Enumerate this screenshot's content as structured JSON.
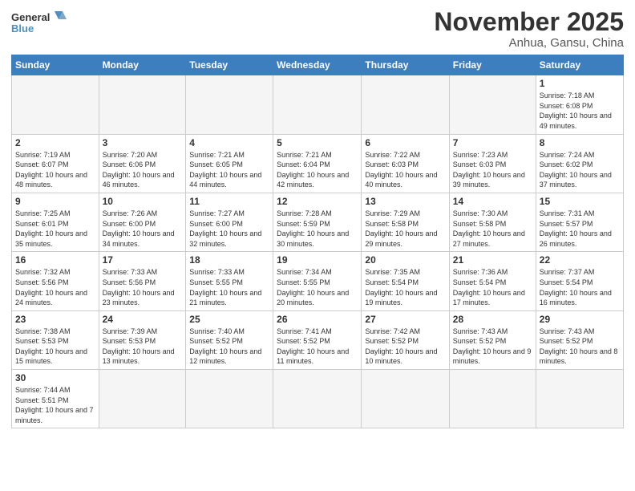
{
  "logo": {
    "text_general": "General",
    "text_blue": "Blue"
  },
  "title": "November 2025",
  "location": "Anhua, Gansu, China",
  "days_of_week": [
    "Sunday",
    "Monday",
    "Tuesday",
    "Wednesday",
    "Thursday",
    "Friday",
    "Saturday"
  ],
  "weeks": [
    [
      {
        "day": "",
        "info": ""
      },
      {
        "day": "",
        "info": ""
      },
      {
        "day": "",
        "info": ""
      },
      {
        "day": "",
        "info": ""
      },
      {
        "day": "",
        "info": ""
      },
      {
        "day": "",
        "info": ""
      },
      {
        "day": "1",
        "info": "Sunrise: 7:18 AM\nSunset: 6:08 PM\nDaylight: 10 hours\nand 49 minutes."
      }
    ],
    [
      {
        "day": "2",
        "info": "Sunrise: 7:19 AM\nSunset: 6:07 PM\nDaylight: 10 hours\nand 48 minutes."
      },
      {
        "day": "3",
        "info": "Sunrise: 7:20 AM\nSunset: 6:06 PM\nDaylight: 10 hours\nand 46 minutes."
      },
      {
        "day": "4",
        "info": "Sunrise: 7:21 AM\nSunset: 6:05 PM\nDaylight: 10 hours\nand 44 minutes."
      },
      {
        "day": "5",
        "info": "Sunrise: 7:21 AM\nSunset: 6:04 PM\nDaylight: 10 hours\nand 42 minutes."
      },
      {
        "day": "6",
        "info": "Sunrise: 7:22 AM\nSunset: 6:03 PM\nDaylight: 10 hours\nand 40 minutes."
      },
      {
        "day": "7",
        "info": "Sunrise: 7:23 AM\nSunset: 6:03 PM\nDaylight: 10 hours\nand 39 minutes."
      },
      {
        "day": "8",
        "info": "Sunrise: 7:24 AM\nSunset: 6:02 PM\nDaylight: 10 hours\nand 37 minutes."
      }
    ],
    [
      {
        "day": "9",
        "info": "Sunrise: 7:25 AM\nSunset: 6:01 PM\nDaylight: 10 hours\nand 35 minutes."
      },
      {
        "day": "10",
        "info": "Sunrise: 7:26 AM\nSunset: 6:00 PM\nDaylight: 10 hours\nand 34 minutes."
      },
      {
        "day": "11",
        "info": "Sunrise: 7:27 AM\nSunset: 6:00 PM\nDaylight: 10 hours\nand 32 minutes."
      },
      {
        "day": "12",
        "info": "Sunrise: 7:28 AM\nSunset: 5:59 PM\nDaylight: 10 hours\nand 30 minutes."
      },
      {
        "day": "13",
        "info": "Sunrise: 7:29 AM\nSunset: 5:58 PM\nDaylight: 10 hours\nand 29 minutes."
      },
      {
        "day": "14",
        "info": "Sunrise: 7:30 AM\nSunset: 5:58 PM\nDaylight: 10 hours\nand 27 minutes."
      },
      {
        "day": "15",
        "info": "Sunrise: 7:31 AM\nSunset: 5:57 PM\nDaylight: 10 hours\nand 26 minutes."
      }
    ],
    [
      {
        "day": "16",
        "info": "Sunrise: 7:32 AM\nSunset: 5:56 PM\nDaylight: 10 hours\nand 24 minutes."
      },
      {
        "day": "17",
        "info": "Sunrise: 7:33 AM\nSunset: 5:56 PM\nDaylight: 10 hours\nand 23 minutes."
      },
      {
        "day": "18",
        "info": "Sunrise: 7:33 AM\nSunset: 5:55 PM\nDaylight: 10 hours\nand 21 minutes."
      },
      {
        "day": "19",
        "info": "Sunrise: 7:34 AM\nSunset: 5:55 PM\nDaylight: 10 hours\nand 20 minutes."
      },
      {
        "day": "20",
        "info": "Sunrise: 7:35 AM\nSunset: 5:54 PM\nDaylight: 10 hours\nand 19 minutes."
      },
      {
        "day": "21",
        "info": "Sunrise: 7:36 AM\nSunset: 5:54 PM\nDaylight: 10 hours\nand 17 minutes."
      },
      {
        "day": "22",
        "info": "Sunrise: 7:37 AM\nSunset: 5:54 PM\nDaylight: 10 hours\nand 16 minutes."
      }
    ],
    [
      {
        "day": "23",
        "info": "Sunrise: 7:38 AM\nSunset: 5:53 PM\nDaylight: 10 hours\nand 15 minutes."
      },
      {
        "day": "24",
        "info": "Sunrise: 7:39 AM\nSunset: 5:53 PM\nDaylight: 10 hours\nand 13 minutes."
      },
      {
        "day": "25",
        "info": "Sunrise: 7:40 AM\nSunset: 5:52 PM\nDaylight: 10 hours\nand 12 minutes."
      },
      {
        "day": "26",
        "info": "Sunrise: 7:41 AM\nSunset: 5:52 PM\nDaylight: 10 hours\nand 11 minutes."
      },
      {
        "day": "27",
        "info": "Sunrise: 7:42 AM\nSunset: 5:52 PM\nDaylight: 10 hours\nand 10 minutes."
      },
      {
        "day": "28",
        "info": "Sunrise: 7:43 AM\nSunset: 5:52 PM\nDaylight: 10 hours\nand 9 minutes."
      },
      {
        "day": "29",
        "info": "Sunrise: 7:43 AM\nSunset: 5:52 PM\nDaylight: 10 hours\nand 8 minutes."
      }
    ],
    [
      {
        "day": "30",
        "info": "Sunrise: 7:44 AM\nSunset: 5:51 PM\nDaylight: 10 hours\nand 7 minutes."
      },
      {
        "day": "",
        "info": ""
      },
      {
        "day": "",
        "info": ""
      },
      {
        "day": "",
        "info": ""
      },
      {
        "day": "",
        "info": ""
      },
      {
        "day": "",
        "info": ""
      },
      {
        "day": "",
        "info": ""
      }
    ]
  ]
}
